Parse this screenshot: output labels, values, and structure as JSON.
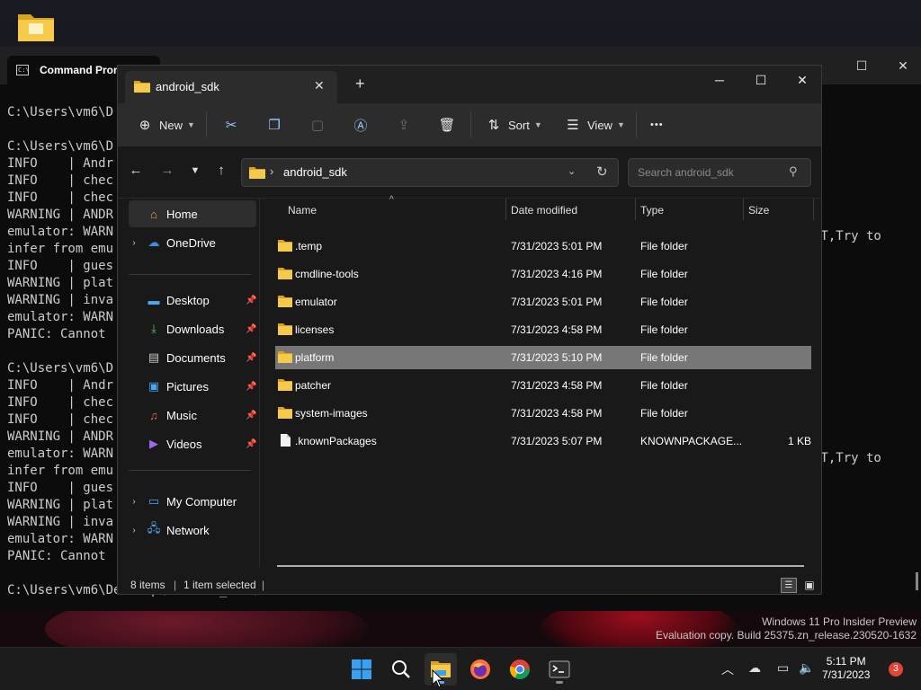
{
  "cmd": {
    "tab_title": "Command Prom",
    "tab_icon_text": "C:\\",
    "lines": [
      "C:\\Users\\vm6\\D",
      "",
      "C:\\Users\\vm6\\D",
      "INFO    | Andr",
      "INFO    | chec",
      "INFO    | chec",
      "WARNING | ANDR",
      "emulator: WARN",
      "infer from emu",
      "INFO    | gues",
      "WARNING | plat",
      "WARNING | inva",
      "emulator: WARN",
      "PANIC: Cannot ",
      "",
      "C:\\Users\\vm6\\D",
      "INFO    | Andr",
      "INFO    | chec",
      "INFO    | chec",
      "WARNING | ANDR",
      "emulator: WARN",
      "infer from emu",
      "INFO    | gues",
      "WARNING | plat",
      "WARNING | inva",
      "emulator: WARN",
      "PANIC: Cannot ",
      "",
      "C:\\Users\\vm6\\Desktop\\android_sdk\\emulator>"
    ],
    "right_text_1": "OT,Try to",
    "right_text_2": "OT,Try to"
  },
  "explorer": {
    "tab_title": "android_sdk",
    "toolbar": {
      "new_label": "New",
      "sort_label": "Sort",
      "view_label": "View",
      "more_label": "•••"
    },
    "address": {
      "path": "android_sdk",
      "search_placeholder": "Search android_sdk"
    },
    "nav": {
      "home": "Home",
      "onedrive": "OneDrive",
      "desktop": "Desktop",
      "downloads": "Downloads",
      "documents": "Documents",
      "pictures": "Pictures",
      "music": "Music",
      "videos": "Videos",
      "my_computer": "My Computer",
      "network": "Network"
    },
    "columns": {
      "name": "Name",
      "date": "Date modified",
      "type": "Type",
      "size": "Size"
    },
    "files": [
      {
        "name": ".temp",
        "date": "7/31/2023 5:01 PM",
        "type": "File folder",
        "size": "",
        "kind": "folder"
      },
      {
        "name": "cmdline-tools",
        "date": "7/31/2023 4:16 PM",
        "type": "File folder",
        "size": "",
        "kind": "folder"
      },
      {
        "name": "emulator",
        "date": "7/31/2023 5:01 PM",
        "type": "File folder",
        "size": "",
        "kind": "folder"
      },
      {
        "name": "licenses",
        "date": "7/31/2023 4:58 PM",
        "type": "File folder",
        "size": "",
        "kind": "folder"
      },
      {
        "name": "platform",
        "date": "7/31/2023 5:10 PM",
        "type": "File folder",
        "size": "",
        "kind": "folder",
        "selected": true
      },
      {
        "name": "patcher",
        "date": "7/31/2023 4:58 PM",
        "type": "File folder",
        "size": "",
        "kind": "folder"
      },
      {
        "name": "system-images",
        "date": "7/31/2023 4:58 PM",
        "type": "File folder",
        "size": "",
        "kind": "folder"
      },
      {
        "name": ".knownPackages",
        "date": "7/31/2023 5:07 PM",
        "type": "KNOWNPACKAGE...",
        "size": "1 KB",
        "kind": "file"
      }
    ],
    "status": {
      "count": "8 items",
      "selected": "1 item selected"
    }
  },
  "watermark": {
    "line1": "Windows 11 Pro Insider Preview",
    "line2": "Evaluation copy. Build 25375.zn_release.230520-1632"
  },
  "taskbar": {
    "time": "5:11 PM",
    "date": "7/31/2023",
    "notifications": "3"
  },
  "colors": {
    "folder_yellow": "#f5c94a",
    "accent_blue": "#60a8ff",
    "selection": "#777777",
    "notification_red": "#e0453a"
  }
}
